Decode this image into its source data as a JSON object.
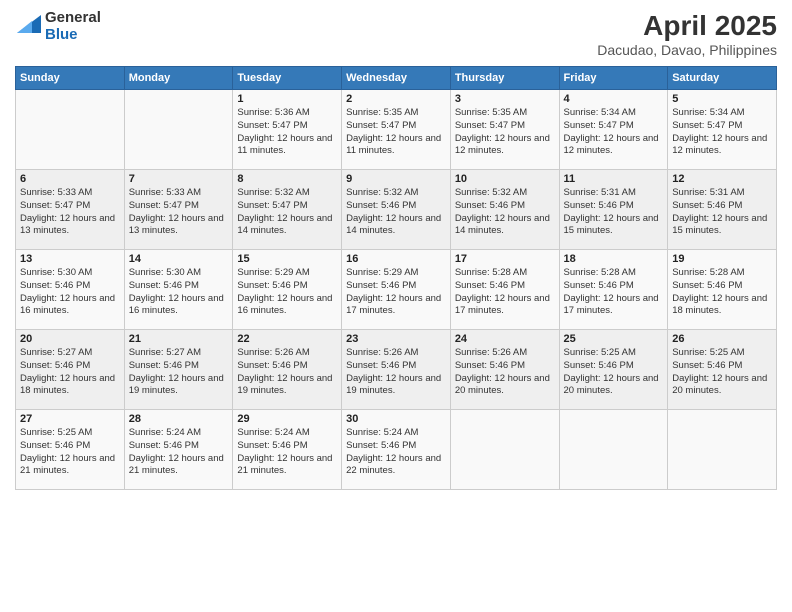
{
  "logo": {
    "line1": "General",
    "line2": "Blue"
  },
  "title": "April 2025",
  "subtitle": "Dacudao, Davao, Philippines",
  "days_of_week": [
    "Sunday",
    "Monday",
    "Tuesday",
    "Wednesday",
    "Thursday",
    "Friday",
    "Saturday"
  ],
  "weeks": [
    [
      {
        "day": "",
        "info": ""
      },
      {
        "day": "",
        "info": ""
      },
      {
        "day": "1",
        "info": "Sunrise: 5:36 AM\nSunset: 5:47 PM\nDaylight: 12 hours and 11 minutes."
      },
      {
        "day": "2",
        "info": "Sunrise: 5:35 AM\nSunset: 5:47 PM\nDaylight: 12 hours and 11 minutes."
      },
      {
        "day": "3",
        "info": "Sunrise: 5:35 AM\nSunset: 5:47 PM\nDaylight: 12 hours and 12 minutes."
      },
      {
        "day": "4",
        "info": "Sunrise: 5:34 AM\nSunset: 5:47 PM\nDaylight: 12 hours and 12 minutes."
      },
      {
        "day": "5",
        "info": "Sunrise: 5:34 AM\nSunset: 5:47 PM\nDaylight: 12 hours and 12 minutes."
      }
    ],
    [
      {
        "day": "6",
        "info": "Sunrise: 5:33 AM\nSunset: 5:47 PM\nDaylight: 12 hours and 13 minutes."
      },
      {
        "day": "7",
        "info": "Sunrise: 5:33 AM\nSunset: 5:47 PM\nDaylight: 12 hours and 13 minutes."
      },
      {
        "day": "8",
        "info": "Sunrise: 5:32 AM\nSunset: 5:47 PM\nDaylight: 12 hours and 14 minutes."
      },
      {
        "day": "9",
        "info": "Sunrise: 5:32 AM\nSunset: 5:46 PM\nDaylight: 12 hours and 14 minutes."
      },
      {
        "day": "10",
        "info": "Sunrise: 5:32 AM\nSunset: 5:46 PM\nDaylight: 12 hours and 14 minutes."
      },
      {
        "day": "11",
        "info": "Sunrise: 5:31 AM\nSunset: 5:46 PM\nDaylight: 12 hours and 15 minutes."
      },
      {
        "day": "12",
        "info": "Sunrise: 5:31 AM\nSunset: 5:46 PM\nDaylight: 12 hours and 15 minutes."
      }
    ],
    [
      {
        "day": "13",
        "info": "Sunrise: 5:30 AM\nSunset: 5:46 PM\nDaylight: 12 hours and 16 minutes."
      },
      {
        "day": "14",
        "info": "Sunrise: 5:30 AM\nSunset: 5:46 PM\nDaylight: 12 hours and 16 minutes."
      },
      {
        "day": "15",
        "info": "Sunrise: 5:29 AM\nSunset: 5:46 PM\nDaylight: 12 hours and 16 minutes."
      },
      {
        "day": "16",
        "info": "Sunrise: 5:29 AM\nSunset: 5:46 PM\nDaylight: 12 hours and 17 minutes."
      },
      {
        "day": "17",
        "info": "Sunrise: 5:28 AM\nSunset: 5:46 PM\nDaylight: 12 hours and 17 minutes."
      },
      {
        "day": "18",
        "info": "Sunrise: 5:28 AM\nSunset: 5:46 PM\nDaylight: 12 hours and 17 minutes."
      },
      {
        "day": "19",
        "info": "Sunrise: 5:28 AM\nSunset: 5:46 PM\nDaylight: 12 hours and 18 minutes."
      }
    ],
    [
      {
        "day": "20",
        "info": "Sunrise: 5:27 AM\nSunset: 5:46 PM\nDaylight: 12 hours and 18 minutes."
      },
      {
        "day": "21",
        "info": "Sunrise: 5:27 AM\nSunset: 5:46 PM\nDaylight: 12 hours and 19 minutes."
      },
      {
        "day": "22",
        "info": "Sunrise: 5:26 AM\nSunset: 5:46 PM\nDaylight: 12 hours and 19 minutes."
      },
      {
        "day": "23",
        "info": "Sunrise: 5:26 AM\nSunset: 5:46 PM\nDaylight: 12 hours and 19 minutes."
      },
      {
        "day": "24",
        "info": "Sunrise: 5:26 AM\nSunset: 5:46 PM\nDaylight: 12 hours and 20 minutes."
      },
      {
        "day": "25",
        "info": "Sunrise: 5:25 AM\nSunset: 5:46 PM\nDaylight: 12 hours and 20 minutes."
      },
      {
        "day": "26",
        "info": "Sunrise: 5:25 AM\nSunset: 5:46 PM\nDaylight: 12 hours and 20 minutes."
      }
    ],
    [
      {
        "day": "27",
        "info": "Sunrise: 5:25 AM\nSunset: 5:46 PM\nDaylight: 12 hours and 21 minutes."
      },
      {
        "day": "28",
        "info": "Sunrise: 5:24 AM\nSunset: 5:46 PM\nDaylight: 12 hours and 21 minutes."
      },
      {
        "day": "29",
        "info": "Sunrise: 5:24 AM\nSunset: 5:46 PM\nDaylight: 12 hours and 21 minutes."
      },
      {
        "day": "30",
        "info": "Sunrise: 5:24 AM\nSunset: 5:46 PM\nDaylight: 12 hours and 22 minutes."
      },
      {
        "day": "",
        "info": ""
      },
      {
        "day": "",
        "info": ""
      },
      {
        "day": "",
        "info": ""
      }
    ]
  ]
}
